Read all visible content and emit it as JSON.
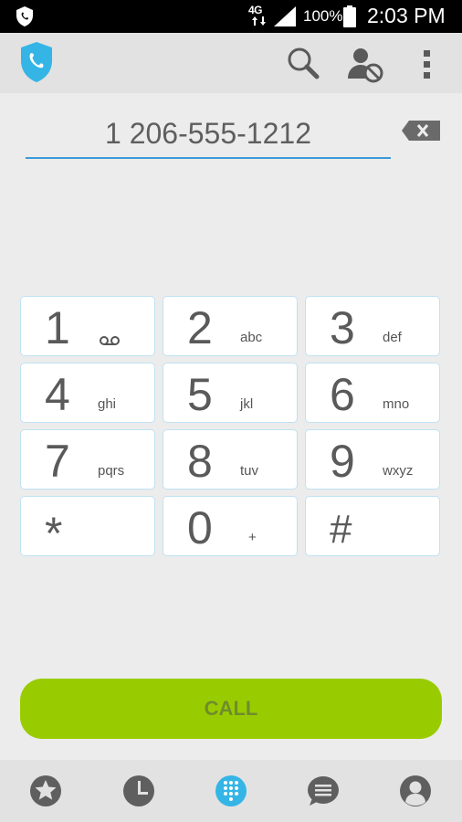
{
  "status_bar": {
    "network_label": "4G",
    "battery_percent": "100%",
    "time": "2:03 PM"
  },
  "dialer": {
    "number": "1 206-555-1212"
  },
  "keypad": [
    {
      "digit": "1",
      "letters": "",
      "voicemail": true
    },
    {
      "digit": "2",
      "letters": "abc"
    },
    {
      "digit": "3",
      "letters": "def"
    },
    {
      "digit": "4",
      "letters": "ghi"
    },
    {
      "digit": "5",
      "letters": "jkl"
    },
    {
      "digit": "6",
      "letters": "mno"
    },
    {
      "digit": "7",
      "letters": "pqrs"
    },
    {
      "digit": "8",
      "letters": "tuv"
    },
    {
      "digit": "9",
      "letters": "wxyz"
    },
    {
      "digit": "*",
      "letters": ""
    },
    {
      "digit": "0",
      "letters": "+"
    },
    {
      "digit": "#",
      "letters": ""
    }
  ],
  "call_button": {
    "label": "CALL"
  },
  "icons": {
    "app_logo": "shield-phone-icon",
    "search": "search-icon",
    "block_contact": "block-contact-icon",
    "overflow": "more-vert-icon",
    "backspace": "backspace-icon",
    "favorites": "star-icon",
    "recents": "clock-icon",
    "dialpad": "dialpad-icon",
    "messages": "message-icon",
    "contacts": "person-icon"
  },
  "colors": {
    "accent_blue": "#3a9ad9",
    "call_green": "#99cc00",
    "active_tab": "#35b5e5"
  }
}
